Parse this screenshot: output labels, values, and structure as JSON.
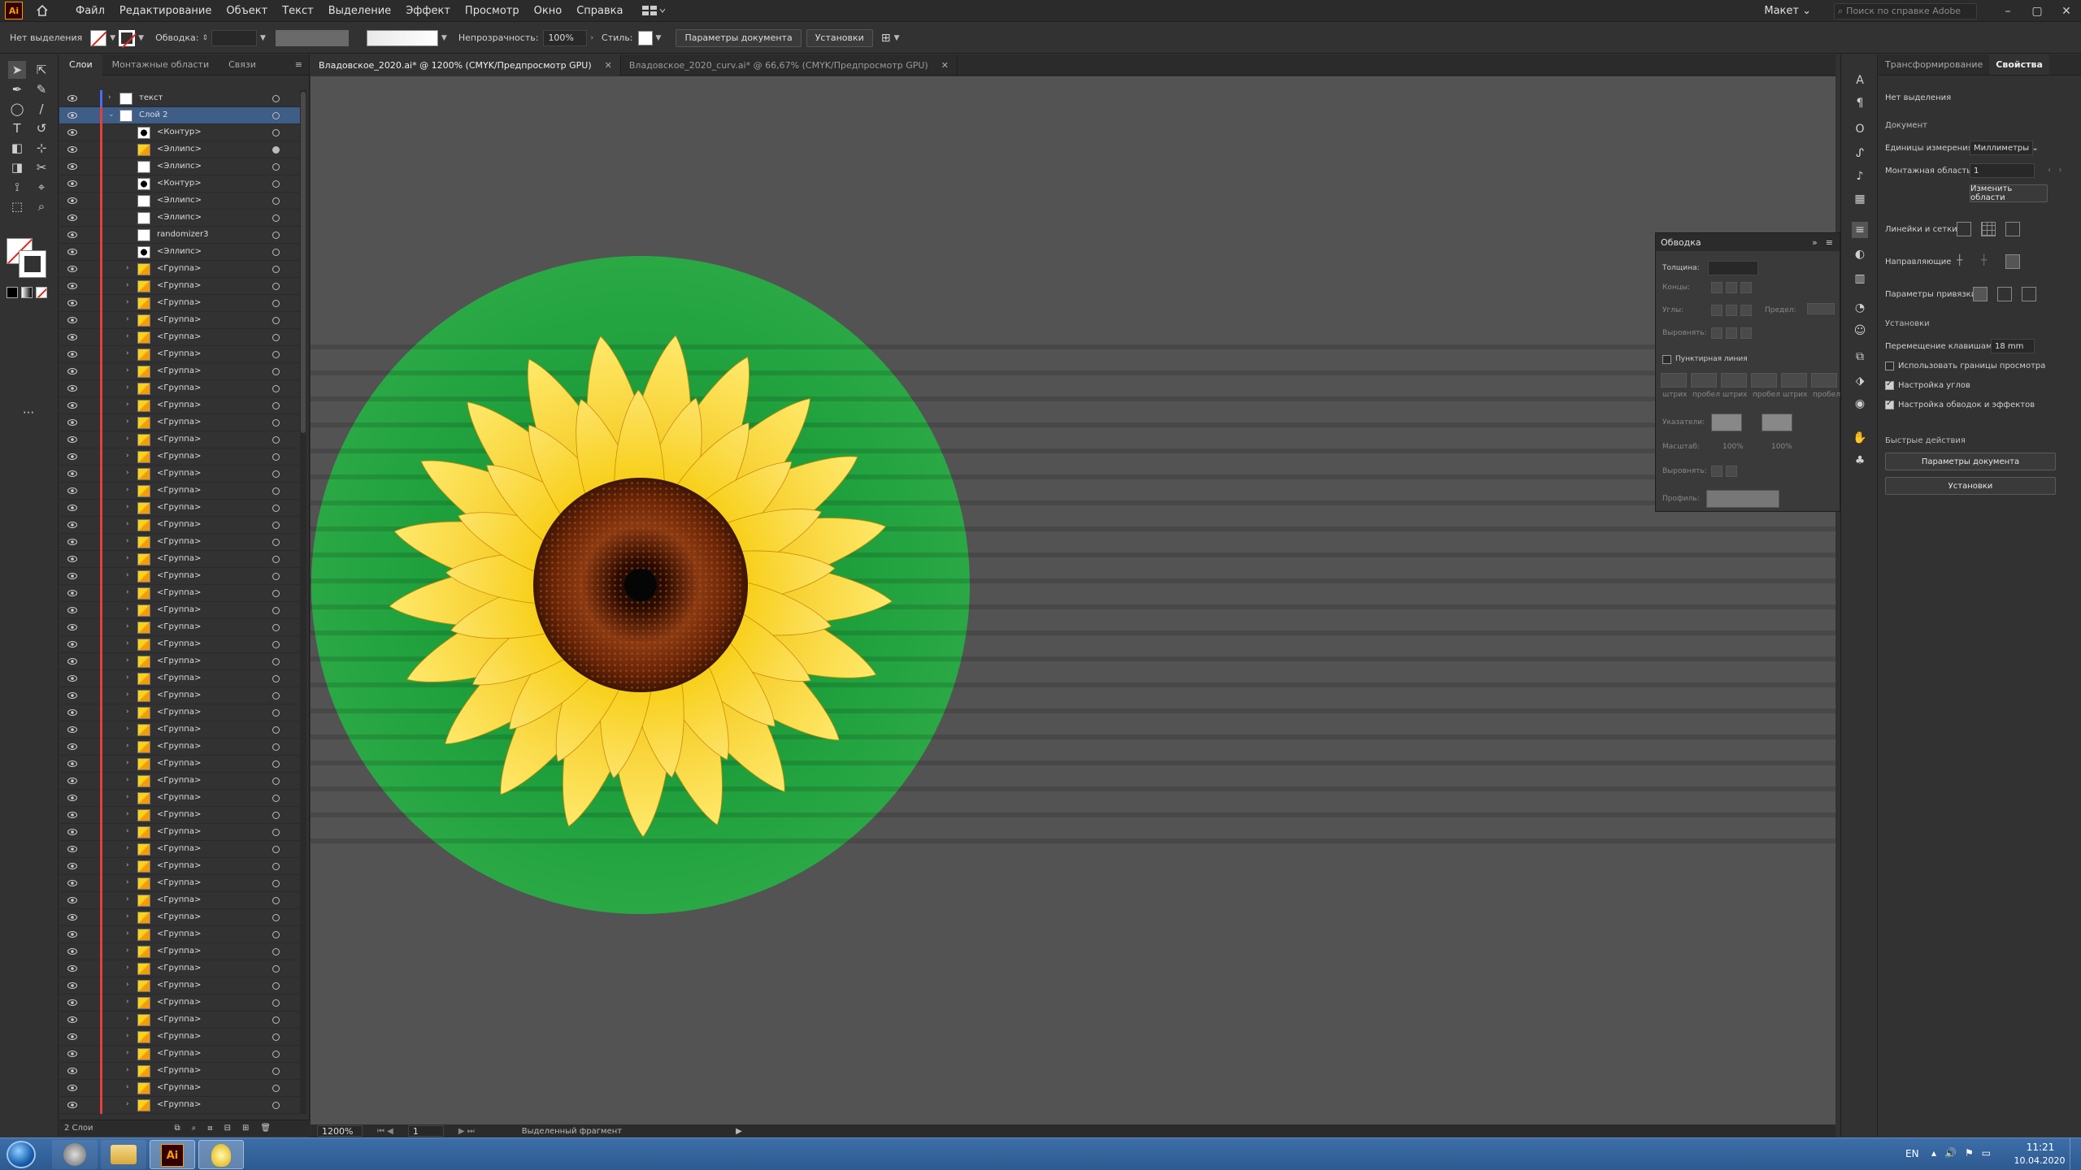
{
  "menubar": {
    "logo": "Ai",
    "items": [
      "Файл",
      "Редактирование",
      "Объект",
      "Текст",
      "Выделение",
      "Эффект",
      "Просмотр",
      "Окно",
      "Справка"
    ],
    "workspace": "Макет",
    "search_placeholder": "Поиск по справке Adobe"
  },
  "controlbar": {
    "selection_state": "Нет выделения",
    "stroke_label": "Обводка:",
    "opacity_label": "Непрозрачность:",
    "opacity_value": "100%",
    "style_label": "Стиль:",
    "doc_setup_button": "Параметры документа",
    "preferences_button": "Установки"
  },
  "layers": {
    "tabs": [
      "Слои",
      "Монтажные области",
      "Связи"
    ],
    "rows": [
      {
        "name": "текст",
        "indent": 0,
        "arrow": "right",
        "thumb": "plain",
        "color": "blue"
      },
      {
        "name": "Слой 2",
        "indent": 0,
        "arrow": "down",
        "thumb": "plain",
        "color": "red",
        "selected": true
      },
      {
        "name": "<Контур>",
        "indent": 1,
        "arrow": "",
        "thumb": "blackc",
        "color": "red"
      },
      {
        "name": "<Эллипс>",
        "indent": 1,
        "arrow": "",
        "thumb": "sun",
        "color": "red",
        "filled": true
      },
      {
        "name": "<Эллипс>",
        "indent": 1,
        "arrow": "",
        "thumb": "plain",
        "color": "red"
      },
      {
        "name": "<Контур>",
        "indent": 1,
        "arrow": "",
        "thumb": "blackc",
        "color": "red"
      },
      {
        "name": "<Эллипс>",
        "indent": 1,
        "arrow": "",
        "thumb": "plain",
        "color": "red"
      },
      {
        "name": "<Эллипс>",
        "indent": 1,
        "arrow": "",
        "thumb": "plain",
        "color": "red"
      },
      {
        "name": "randomizer3",
        "indent": 1,
        "arrow": "",
        "thumb": "plain",
        "color": "red"
      },
      {
        "name": "<Эллипс>",
        "indent": 1,
        "arrow": "",
        "thumb": "blackc",
        "color": "red"
      },
      {
        "name": "<Группа>",
        "indent": 1,
        "arrow": "right",
        "thumb": "sun",
        "color": "red"
      },
      {
        "name": "<Группа>",
        "indent": 1,
        "arrow": "right",
        "thumb": "sun",
        "color": "red"
      },
      {
        "name": "<Группа>",
        "indent": 1,
        "arrow": "right",
        "thumb": "sun",
        "color": "red"
      },
      {
        "name": "<Группа>",
        "indent": 1,
        "arrow": "right",
        "thumb": "sun",
        "color": "red"
      },
      {
        "name": "<Группа>",
        "indent": 1,
        "arrow": "right",
        "thumb": "sun",
        "color": "red"
      },
      {
        "name": "<Группа>",
        "indent": 1,
        "arrow": "right",
        "thumb": "sun",
        "color": "red"
      },
      {
        "name": "<Группа>",
        "indent": 1,
        "arrow": "right",
        "thumb": "sun",
        "color": "red"
      },
      {
        "name": "<Группа>",
        "indent": 1,
        "arrow": "right",
        "thumb": "sun",
        "color": "red"
      },
      {
        "name": "<Группа>",
        "indent": 1,
        "arrow": "right",
        "thumb": "sun",
        "color": "red"
      },
      {
        "name": "<Группа>",
        "indent": 1,
        "arrow": "right",
        "thumb": "sun",
        "color": "red"
      },
      {
        "name": "<Группа>",
        "indent": 1,
        "arrow": "right",
        "thumb": "sun",
        "color": "red"
      },
      {
        "name": "<Группа>",
        "indent": 1,
        "arrow": "right",
        "thumb": "sun",
        "color": "red"
      },
      {
        "name": "<Группа>",
        "indent": 1,
        "arrow": "right",
        "thumb": "sun",
        "color": "red"
      },
      {
        "name": "<Группа>",
        "indent": 1,
        "arrow": "right",
        "thumb": "sun",
        "color": "red"
      },
      {
        "name": "<Группа>",
        "indent": 1,
        "arrow": "right",
        "thumb": "sun",
        "color": "red"
      },
      {
        "name": "<Группа>",
        "indent": 1,
        "arrow": "right",
        "thumb": "sun",
        "color": "red"
      },
      {
        "name": "<Группа>",
        "indent": 1,
        "arrow": "right",
        "thumb": "sun",
        "color": "red"
      },
      {
        "name": "<Группа>",
        "indent": 1,
        "arrow": "right",
        "thumb": "sun",
        "color": "red"
      },
      {
        "name": "<Группа>",
        "indent": 1,
        "arrow": "right",
        "thumb": "sun",
        "color": "red"
      },
      {
        "name": "<Группа>",
        "indent": 1,
        "arrow": "right",
        "thumb": "sun",
        "color": "red"
      },
      {
        "name": "<Группа>",
        "indent": 1,
        "arrow": "right",
        "thumb": "sun",
        "color": "red"
      },
      {
        "name": "<Группа>",
        "indent": 1,
        "arrow": "right",
        "thumb": "sun",
        "color": "red"
      },
      {
        "name": "<Группа>",
        "indent": 1,
        "arrow": "right",
        "thumb": "sun",
        "color": "red"
      },
      {
        "name": "<Группа>",
        "indent": 1,
        "arrow": "right",
        "thumb": "sun",
        "color": "red"
      },
      {
        "name": "<Группа>",
        "indent": 1,
        "arrow": "right",
        "thumb": "sun",
        "color": "red"
      },
      {
        "name": "<Группа>",
        "indent": 1,
        "arrow": "right",
        "thumb": "sun",
        "color": "red"
      },
      {
        "name": "<Группа>",
        "indent": 1,
        "arrow": "right",
        "thumb": "sun",
        "color": "red"
      },
      {
        "name": "<Группа>",
        "indent": 1,
        "arrow": "right",
        "thumb": "sun",
        "color": "red"
      },
      {
        "name": "<Группа>",
        "indent": 1,
        "arrow": "right",
        "thumb": "sun",
        "color": "red"
      },
      {
        "name": "<Группа>",
        "indent": 1,
        "arrow": "right",
        "thumb": "sun",
        "color": "red"
      },
      {
        "name": "<Группа>",
        "indent": 1,
        "arrow": "right",
        "thumb": "sun",
        "color": "red"
      },
      {
        "name": "<Группа>",
        "indent": 1,
        "arrow": "right",
        "thumb": "sun",
        "color": "red"
      },
      {
        "name": "<Группа>",
        "indent": 1,
        "arrow": "right",
        "thumb": "sun",
        "color": "red"
      },
      {
        "name": "<Группа>",
        "indent": 1,
        "arrow": "right",
        "thumb": "sun",
        "color": "red"
      },
      {
        "name": "<Группа>",
        "indent": 1,
        "arrow": "right",
        "thumb": "sun",
        "color": "red"
      },
      {
        "name": "<Группа>",
        "indent": 1,
        "arrow": "right",
        "thumb": "sun",
        "color": "red"
      },
      {
        "name": "<Группа>",
        "indent": 1,
        "arrow": "right",
        "thumb": "sun",
        "color": "red"
      },
      {
        "name": "<Группа>",
        "indent": 1,
        "arrow": "right",
        "thumb": "sun",
        "color": "red"
      },
      {
        "name": "<Группа>",
        "indent": 1,
        "arrow": "right",
        "thumb": "sun",
        "color": "red"
      },
      {
        "name": "<Группа>",
        "indent": 1,
        "arrow": "right",
        "thumb": "sun",
        "color": "red"
      },
      {
        "name": "<Группа>",
        "indent": 1,
        "arrow": "right",
        "thumb": "sun",
        "color": "red"
      },
      {
        "name": "<Группа>",
        "indent": 1,
        "arrow": "right",
        "thumb": "sun",
        "color": "red"
      },
      {
        "name": "<Группа>",
        "indent": 1,
        "arrow": "right",
        "thumb": "sun",
        "color": "red"
      },
      {
        "name": "<Группа>",
        "indent": 1,
        "arrow": "right",
        "thumb": "sun",
        "color": "red"
      },
      {
        "name": "<Группа>",
        "indent": 1,
        "arrow": "right",
        "thumb": "sun",
        "color": "red"
      },
      {
        "name": "<Группа>",
        "indent": 1,
        "arrow": "right",
        "thumb": "sun",
        "color": "red"
      },
      {
        "name": "<Группа>",
        "indent": 1,
        "arrow": "right",
        "thumb": "sun",
        "color": "red"
      },
      {
        "name": "<Группа>",
        "indent": 1,
        "arrow": "right",
        "thumb": "sun",
        "color": "red"
      },
      {
        "name": "<Группа>",
        "indent": 1,
        "arrow": "right",
        "thumb": "sun",
        "color": "red"
      },
      {
        "name": "<Группа>",
        "indent": 1,
        "arrow": "right",
        "thumb": "sun",
        "color": "red"
      }
    ],
    "footer": "2 Слои"
  },
  "documents": {
    "tabs": [
      {
        "title": "Владовское_2020.ai* @ 1200% (CMYK/Предпросмотр GPU)",
        "active": true
      },
      {
        "title": "Владовское_2020_curv.ai* @ 66,67% (CMYK/Предпросмотр GPU)",
        "active": false
      }
    ],
    "zoom": "1200%",
    "artboard": "1",
    "status": "Выделенный фрагмент"
  },
  "stroke_panel": {
    "title": "Обводка",
    "weight_label": "Толщина:",
    "cap_label": "Концы:",
    "corner_label": "Углы:",
    "limit_label": "Предел:",
    "align_label": "Выровнять:",
    "dashed_label": "Пунктирная линия",
    "dash_labels": [
      "штрих",
      "пробел",
      "штрих",
      "пробел",
      "штрих",
      "пробел"
    ],
    "arrows_label": "Указатели:",
    "scale_label": "Масштаб:",
    "scale_values": [
      "100%",
      "100%"
    ],
    "align2_label": "Выровнять:",
    "profile_label": "Профиль:"
  },
  "properties": {
    "tabs": [
      "Трансформирование",
      "Свойства"
    ],
    "no_selection": "Нет выделения",
    "document_header": "Документ",
    "units_label": "Единицы измерения:",
    "units_value": "Миллиметры",
    "artboard_label": "Монтажная область:",
    "artboard_value": "1",
    "edit_artboards_button": "Изменить области",
    "rulers_label": "Линейки и сетки",
    "guides_label": "Направляющие",
    "snap_label": "Параметры привязки",
    "prefs_header": "Установки",
    "keyboard_increment_label": "Перемещение клавишами:",
    "keyboard_increment_value": "18 mm",
    "use_preview_bounds": "Использовать границы просмотра",
    "scale_corners": "Настройка углов",
    "scale_strokes": "Настройка обводок и эффектов",
    "quick_actions_header": "Быстрые действия",
    "doc_setup_button": "Параметры документа",
    "preferences_button": "Установки"
  },
  "taskbar": {
    "lang": "EN",
    "time": "11:21",
    "date": "10.04.2020"
  },
  "colors": {
    "canvas_green": "#1f9a3c",
    "petal_yellow": "#f6d21a",
    "center_brown": "#7a2e0a",
    "layer_red": "#e0403f",
    "selection_blue": "#3e5d87"
  }
}
